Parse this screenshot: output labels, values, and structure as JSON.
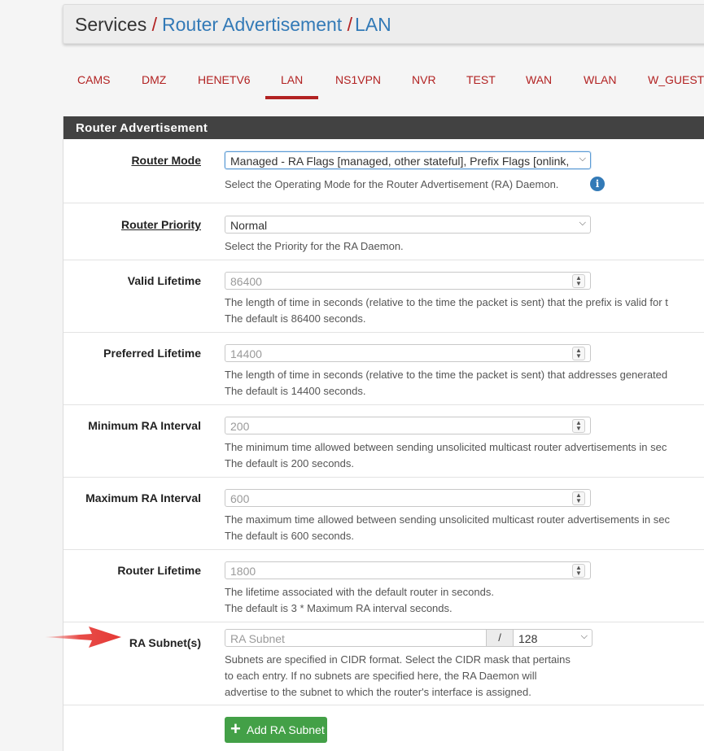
{
  "breadcrumb": {
    "part1": "Services",
    "sep1": "/",
    "part2": "Router Advertisement",
    "sep2": "/",
    "part3": "LAN"
  },
  "tabs": [
    {
      "label": "CAMS"
    },
    {
      "label": "DMZ"
    },
    {
      "label": "HENETV6"
    },
    {
      "label": "LAN",
      "active": true
    },
    {
      "label": "NS1VPN"
    },
    {
      "label": "NVR"
    },
    {
      "label": "TEST"
    },
    {
      "label": "WAN"
    },
    {
      "label": "WLAN"
    },
    {
      "label": "W_GUEST"
    }
  ],
  "panel": {
    "title": "Router Advertisement"
  },
  "fields": {
    "router_mode": {
      "label": "Router Mode",
      "value": "Managed - RA Flags [managed, other stateful], Prefix Flags [onlink, ro",
      "help": "Select the Operating Mode for the Router Advertisement (RA) Daemon."
    },
    "router_priority": {
      "label": "Router Priority",
      "value": "Normal",
      "help": "Select the Priority for the RA Daemon."
    },
    "valid_lifetime": {
      "label": "Valid Lifetime",
      "placeholder": "86400",
      "help1": "The length of time in seconds (relative to the time the packet is sent) that the prefix is valid for t",
      "help2": "The default is 86400 seconds."
    },
    "preferred_lifetime": {
      "label": "Preferred Lifetime",
      "placeholder": "14400",
      "help1": "The length of time in seconds (relative to the time the packet is sent) that addresses generated",
      "help2": "The default is 14400 seconds."
    },
    "min_ra_interval": {
      "label": "Minimum RA Interval",
      "placeholder": "200",
      "help1": "The minimum time allowed between sending unsolicited multicast router advertisements in sec",
      "help2": "The default is 200 seconds."
    },
    "max_ra_interval": {
      "label": "Maximum RA Interval",
      "placeholder": "600",
      "help1": "The maximum time allowed between sending unsolicited multicast router advertisements in sec",
      "help2": "The default is 600 seconds."
    },
    "router_lifetime": {
      "label": "Router Lifetime",
      "placeholder": "1800",
      "help1": "The lifetime associated with the default router in seconds.",
      "help2": "The default is 3 * Maximum RA interval seconds."
    },
    "ra_subnets": {
      "label": "RA Subnet(s)",
      "placeholder": "RA Subnet",
      "slash": "/",
      "mask": "128",
      "help1": "Subnets are specified in CIDR format. Select the CIDR mask that pertains",
      "help2": "to each entry. If no subnets are specified here, the RA Daemon will",
      "help3": "advertise to the subnet to which the router's interface is assigned."
    }
  },
  "add_button": {
    "icon": "plus-icon",
    "label": "Add RA Subnet"
  },
  "colors": {
    "accent_red": "#b22222",
    "link_blue": "#337ab7",
    "panel_header": "#424242",
    "button_green": "#43a047",
    "annotation_arrow": "#e53935"
  },
  "icons": {
    "info": "info-icon",
    "annotation": "red-arrow-icon"
  }
}
